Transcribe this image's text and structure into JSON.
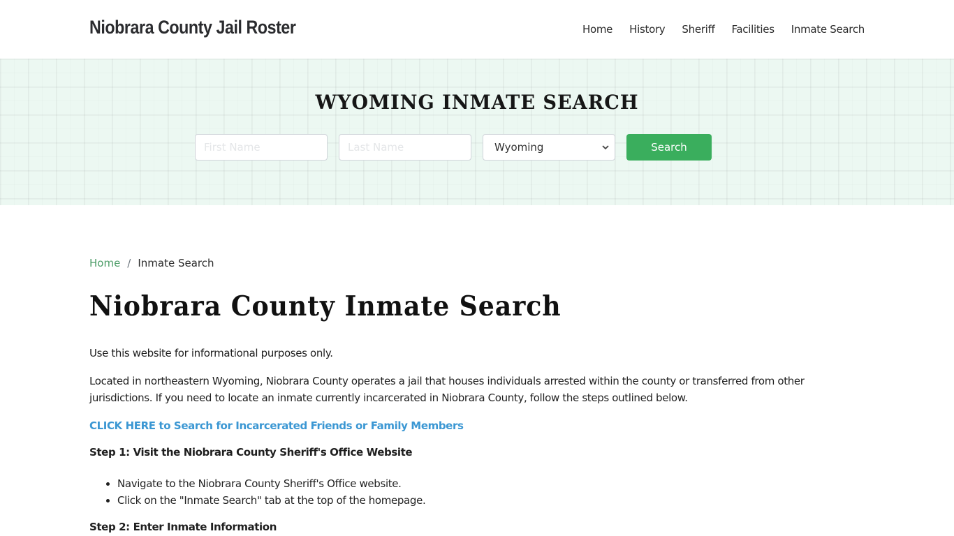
{
  "header": {
    "brand": "Niobrara County Jail Roster",
    "nav": [
      {
        "label": "Home"
      },
      {
        "label": "History"
      },
      {
        "label": "Sheriff"
      },
      {
        "label": "Facilities"
      },
      {
        "label": "Inmate Search"
      }
    ]
  },
  "hero": {
    "title": "WYOMING INMATE SEARCH",
    "first_name_placeholder": "First Name",
    "last_name_placeholder": "Last Name",
    "state_selected": "Wyoming",
    "search_label": "Search",
    "accent_color": "#3aae5d"
  },
  "breadcrumb": {
    "home": "Home",
    "separator": "/",
    "current": "Inmate Search"
  },
  "main": {
    "title": "Niobrara County Inmate Search",
    "intro": "Use this website for informational purposes only.",
    "description": "Located in northeastern Wyoming, Niobrara County operates a jail that houses individuals arrested within the county or transferred from other jurisdictions. If you need to locate an inmate currently incarcerated in Niobrara County, follow the steps outlined below.",
    "cta_link": "CLICK HERE to Search for Incarcerated Friends or Family Members",
    "step1_heading": "Step 1: Visit the Niobrara County Sheriff's Office Website",
    "step1_items": [
      "Navigate to the Niobrara County Sheriff's Office website.",
      "Click on the \"Inmate Search\" tab at the top of the homepage."
    ],
    "step2_heading": "Step 2: Enter Inmate Information"
  }
}
